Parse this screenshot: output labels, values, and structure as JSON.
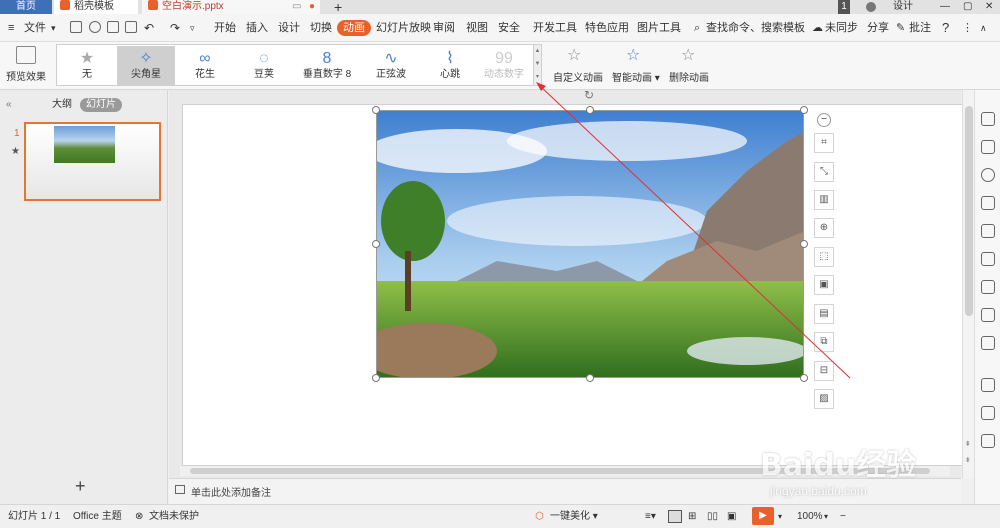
{
  "tabs": [
    {
      "label": "首页"
    },
    {
      "label": "稻壳模板"
    },
    {
      "label": "空白演示.pptx"
    }
  ],
  "titlebar": {
    "badge": "1",
    "design_label": "设计"
  },
  "menubar": {
    "file_label": "文件",
    "items": [
      "开始",
      "插入",
      "设计",
      "切换",
      "动画",
      "幻灯片放映",
      "审阅",
      "视图",
      "安全",
      "开发工具",
      "特色应用",
      "图片工具"
    ],
    "active": "动画",
    "search_placeholder": "查找命令、搜索模板",
    "sync_label": "未同步",
    "share_label": "分享",
    "comment_label": "批注",
    "help_label": "?"
  },
  "ribbon": {
    "preview_label": "预览效果",
    "gallery": [
      {
        "label": "无",
        "icon": "★"
      },
      {
        "label": "尖角星",
        "icon": "✧"
      },
      {
        "label": "花生",
        "icon": "∞"
      },
      {
        "label": "豆荚",
        "icon": "◌"
      },
      {
        "label": "垂直数字 8",
        "icon": "8"
      },
      {
        "label": "正弦波",
        "icon": "∿"
      },
      {
        "label": "心跳",
        "icon": "⌇"
      },
      {
        "label": "动态数字",
        "icon": "99"
      }
    ],
    "selected": "尖角星",
    "custom_label": "自定义动画",
    "smart_label": "智能动画",
    "delete_label": "删除动画"
  },
  "leftpane": {
    "outline_tab": "大纲",
    "slides_tab": "幻灯片",
    "slide_number": "1",
    "add_label": "+"
  },
  "notes": {
    "placeholder": "单击此处添加备注"
  },
  "statusbar": {
    "slide_info": "幻灯片 1 / 1",
    "theme": "Office 主题",
    "protect": "文档未保护",
    "beautify": "一键美化",
    "zoom": "100%"
  },
  "watermark": {
    "main": "Baidu经验",
    "sub": "jingyan.baidu.com"
  },
  "colors": {
    "accent": "#e8612c",
    "home_tab": "#3f6fb6",
    "selection": "#e8752f"
  }
}
